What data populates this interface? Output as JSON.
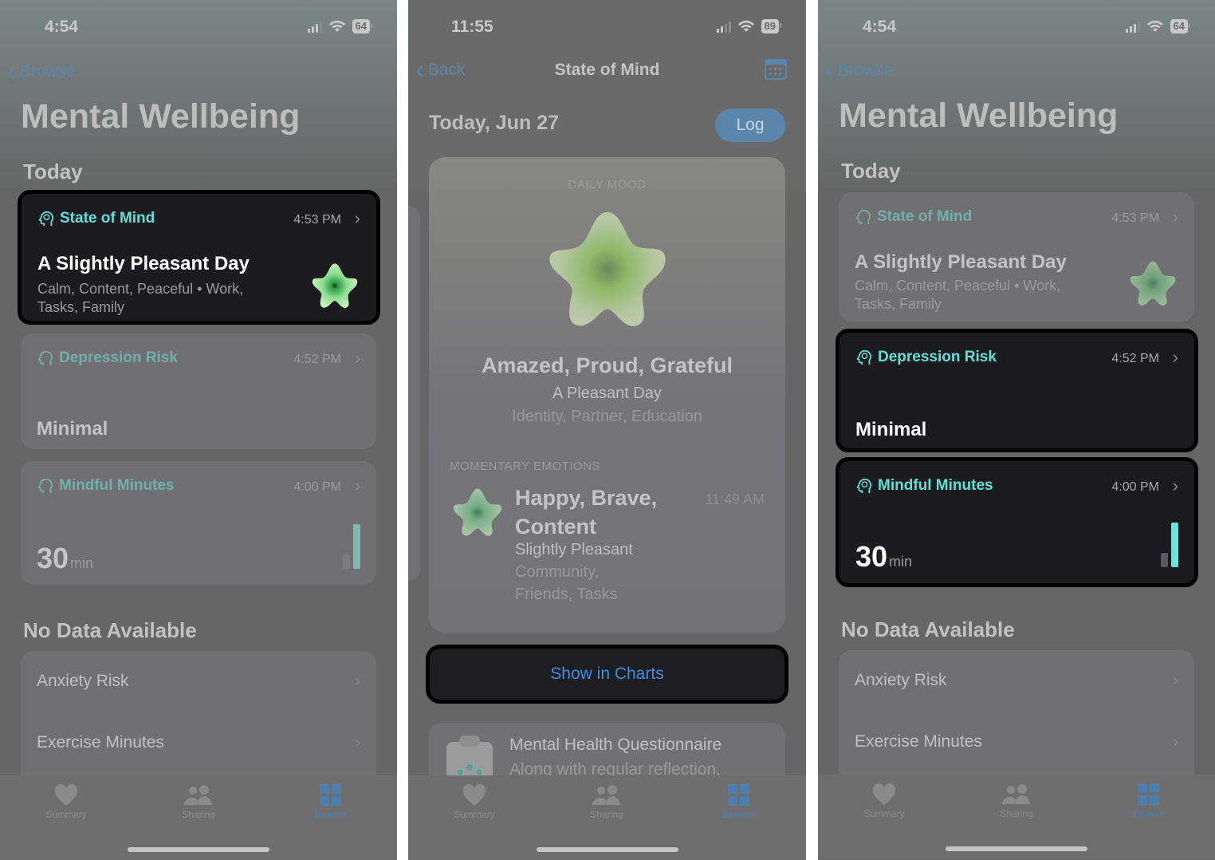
{
  "screens": [
    {
      "status": {
        "time": "4:54",
        "battery": "64"
      },
      "nav": {
        "back_label": "Browse"
      },
      "title": "Mental Wellbeing",
      "section_today": "Today",
      "cards": {
        "state_of_mind": {
          "label": "State of Mind",
          "time": "4:53 PM",
          "headline": "A Slightly Pleasant Day",
          "details": "Calm, Content, Peaceful • Work, Tasks, Family"
        },
        "depression_risk": {
          "label": "Depression Risk",
          "time": "4:52 PM",
          "value": "Minimal"
        },
        "mindful_minutes": {
          "label": "Mindful Minutes",
          "time": "4:00 PM",
          "value": "30",
          "unit": "min"
        }
      },
      "highlighted": "state_of_mind",
      "section_nodata": "No Data Available",
      "nodata_items": [
        "Anxiety Risk",
        "Exercise Minutes"
      ]
    },
    {
      "status": {
        "time": "11:55",
        "battery": "89"
      },
      "nav": {
        "back_label": "Back",
        "title": "State of Mind"
      },
      "date_header": "Today, Jun 27",
      "log_label": "Log",
      "daily_mood": {
        "caption": "DAILY MOOD",
        "emotions": "Amazed, Proud, Grateful",
        "feeling": "A Pleasant Day",
        "associations": "Identity, Partner, Education"
      },
      "momentary": {
        "caption": "MOMENTARY EMOTIONS",
        "emotions_line1": "Happy, Brave,",
        "emotions_line2": "Content",
        "time": "11:49 AM",
        "feeling": "Slightly Pleasant",
        "associations_line1": "Community,",
        "associations_line2": "Friends, Tasks"
      },
      "show_in_charts": "Show in Charts",
      "questionnaire": {
        "title": "Mental Health Questionnaire",
        "subtitle": "Along with regular reflection,"
      }
    },
    {
      "status": {
        "time": "4:54",
        "battery": "64"
      },
      "nav": {
        "back_label": "Browse"
      },
      "title": "Mental Wellbeing",
      "section_today": "Today",
      "cards": {
        "state_of_mind": {
          "label": "State of Mind",
          "time": "4:53 PM",
          "headline": "A Slightly Pleasant Day",
          "details": "Calm, Content, Peaceful • Work, Tasks, Family"
        },
        "depression_risk": {
          "label": "Depression Risk",
          "time": "4:52 PM",
          "value": "Minimal"
        },
        "mindful_minutes": {
          "label": "Mindful Minutes",
          "time": "4:00 PM",
          "value": "30",
          "unit": "min"
        }
      },
      "highlighted": "depression_risk, mindful_minutes",
      "section_nodata": "No Data Available",
      "nodata_items": [
        "Anxiety Risk",
        "Exercise Minutes"
      ]
    }
  ],
  "tabbar": {
    "items": [
      "Summary",
      "Sharing",
      "Browse"
    ],
    "active": "Browse"
  },
  "colors": {
    "accent_teal": "#5fe0d8",
    "link_blue": "#3a8ee6",
    "dim_blue": "#5a86ad",
    "card_dark": "#1c1c1e"
  }
}
